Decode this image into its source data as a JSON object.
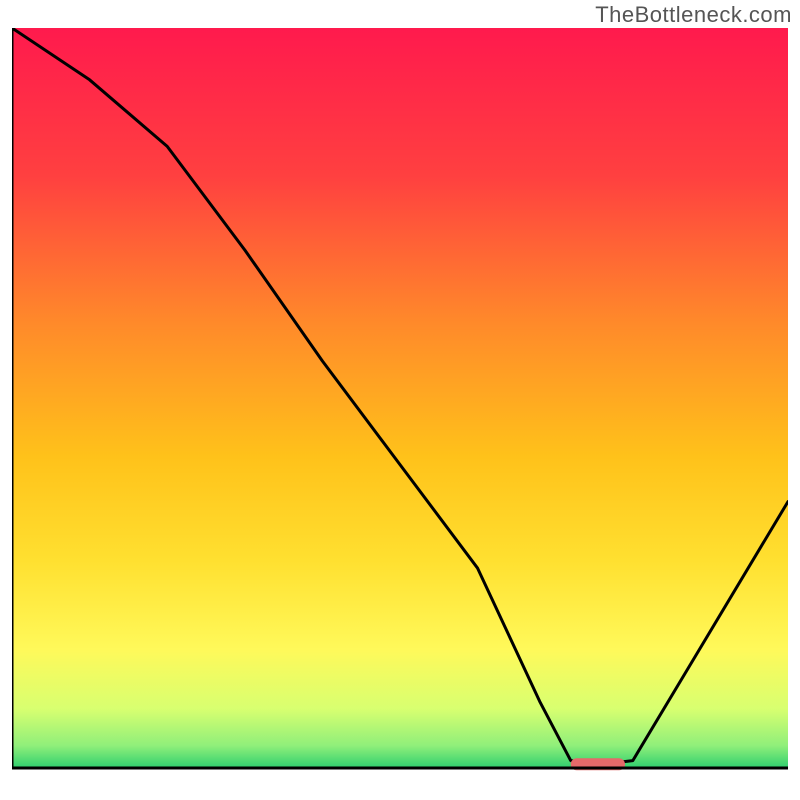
{
  "watermark": "TheBottleneck.com",
  "chart_data": {
    "type": "line",
    "title": "",
    "xlabel": "",
    "ylabel": "",
    "xlim": [
      0,
      100
    ],
    "ylim": [
      0,
      100
    ],
    "series": [
      {
        "name": "bottleneck-curve",
        "x": [
          0,
          10,
          20,
          30,
          40,
          50,
          60,
          68,
          72,
          76,
          80,
          88,
          100
        ],
        "y": [
          100,
          93,
          84,
          70,
          55,
          41,
          27,
          9,
          1,
          0.5,
          1,
          15,
          36
        ],
        "color": "#000000"
      }
    ],
    "marker": {
      "name": "optimal-range",
      "x_start": 72,
      "x_end": 79,
      "y": 0.5,
      "color": "#e66a6a"
    },
    "gradient_stops": [
      {
        "offset": 0.0,
        "color": "#ff1a4d"
      },
      {
        "offset": 0.2,
        "color": "#ff4040"
      },
      {
        "offset": 0.4,
        "color": "#ff8a2a"
      },
      {
        "offset": 0.58,
        "color": "#ffc21a"
      },
      {
        "offset": 0.72,
        "color": "#ffe030"
      },
      {
        "offset": 0.84,
        "color": "#fff95a"
      },
      {
        "offset": 0.92,
        "color": "#d8ff70"
      },
      {
        "offset": 0.97,
        "color": "#8fef7a"
      },
      {
        "offset": 1.0,
        "color": "#2fcf6f"
      }
    ],
    "axis_color": "#000000"
  }
}
